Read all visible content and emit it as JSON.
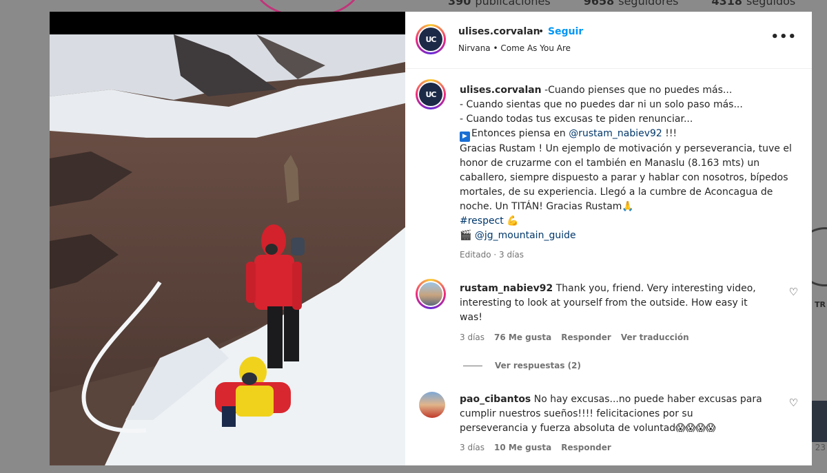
{
  "background": {
    "stats": [
      {
        "count": "390",
        "label": "publicaciones"
      },
      {
        "count": "9658",
        "label": "seguidores"
      },
      {
        "count": "4318",
        "label": "seguidos"
      }
    ],
    "right_text": "TR",
    "right_number": "23"
  },
  "post": {
    "header": {
      "avatar_text": "UC",
      "username": "ulises.corvalan",
      "dot": "•",
      "follow_label": "Seguir",
      "audio": "Nirvana • Come As You Are",
      "more_icon": "more-horizontal-icon",
      "more_label": "•••"
    },
    "caption": {
      "username": "ulises.corvalan",
      "line1": " -Cuando pienses que no puedes más...",
      "line2": "- Cuando sientas que no puedes dar ni un solo paso más...",
      "line3": "- Cuando todas tus excusas te piden renunciar...",
      "line4_prefix": "Entonces piensa en ",
      "line4_mention": "@rustam_nabiev92",
      "line4_suffix": " !!!",
      "body": "Gracias Rustam ! Un ejemplo de motivación y perseverancia, tuve el honor de cruzarme con el también en Manaslu (8.163 mts) un caballero, siempre dispuesto a parar y hablar con nosotros, bípedos mortales, de su experiencia. Llegó a la cumbre de Aconcagua de noche. Un TITÁN! Gracias Rustam🙏",
      "hashtag": "#respect",
      "hashtag_emoji": "💪",
      "credit_icon": "🎬",
      "credit_mention": "@jg_mountain_guide",
      "play_icon": "▶",
      "edited": "Editado · 3 días"
    },
    "comments": [
      {
        "username": "rustam_nabiev92",
        "text": " Thank you, friend. Very interesting video, interesting to look at yourself from the outside. How easy it was!",
        "time": "3 días",
        "likes": "76 Me gusta",
        "reply_label": "Responder",
        "translate_label": "Ver traducción",
        "view_replies": "Ver respuestas (2)"
      },
      {
        "username": "pao_cibantos",
        "text": " No hay excusas...no puede haber excusas para cumplir nuestros sueños!!!! felicitaciones por su perseverancia y fuerza absoluta de voluntad😱😱😱😱",
        "time": "3 días",
        "likes": "10 Me gusta",
        "reply_label": "Responder"
      }
    ],
    "like_icon": "♡"
  },
  "colors": {
    "accent": "#0095f6",
    "mention": "#00376b",
    "muted": "#737373"
  }
}
